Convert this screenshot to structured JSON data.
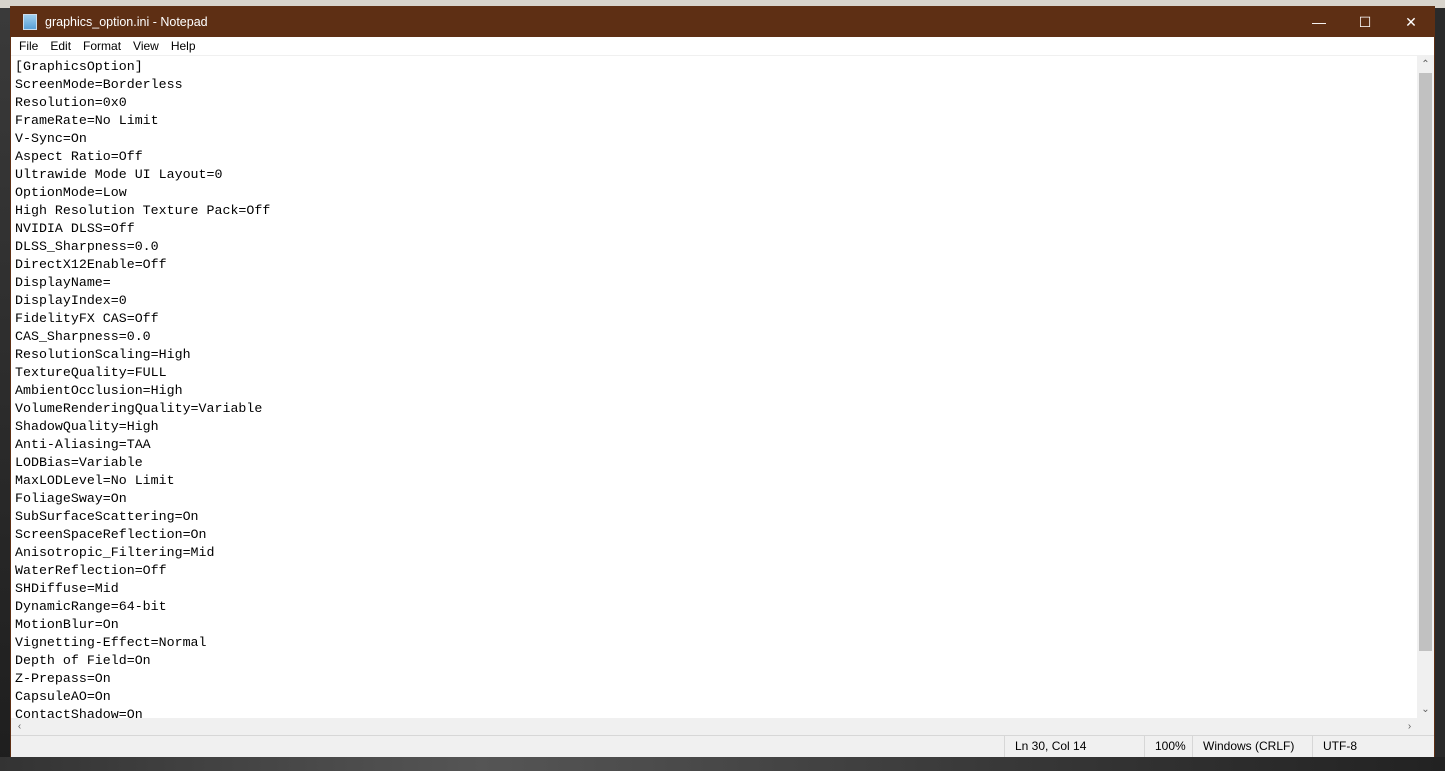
{
  "window": {
    "title": "graphics_option.ini - Notepad",
    "controls": {
      "minimize": "—",
      "maximize": "☐",
      "close": "✕"
    }
  },
  "menu": [
    "File",
    "Edit",
    "Format",
    "View",
    "Help"
  ],
  "lines": [
    "[GraphicsOption]",
    "ScreenMode=Borderless",
    "Resolution=0x0",
    "FrameRate=No Limit",
    "V-Sync=On",
    "Aspect Ratio=Off",
    "Ultrawide Mode UI Layout=0",
    "OptionMode=Low",
    "High Resolution Texture Pack=Off",
    "NVIDIA DLSS=Off",
    "DLSS_Sharpness=0.0",
    "DirectX12Enable=Off",
    "DisplayName=",
    "DisplayIndex=0",
    "FidelityFX CAS=Off",
    "CAS_Sharpness=0.0",
    "ResolutionScaling=High",
    "TextureQuality=FULL",
    "AmbientOcclusion=High",
    "VolumeRenderingQuality=Variable",
    "ShadowQuality=High",
    "Anti-Aliasing=TAA",
    "LODBias=Variable",
    "MaxLODLevel=No Limit",
    "FoliageSway=On",
    "SubSurfaceScattering=On",
    "ScreenSpaceReflection=On",
    "Anisotropic_Filtering=Mid",
    "WaterReflection=Off",
    "SHDiffuse=Mid",
    "DynamicRange=64-bit",
    "MotionBlur=On",
    "Vignetting-Effect=Normal",
    "Depth of Field=On",
    "Z-Prepass=On",
    "CapsuleAO=On",
    "ContactShadow=On"
  ],
  "status": {
    "position": "Ln 30, Col 14",
    "zoom": "100%",
    "line_ending": "Windows (CRLF)",
    "encoding": "UTF-8"
  },
  "colors": {
    "titlebar": "#5e2f14"
  }
}
